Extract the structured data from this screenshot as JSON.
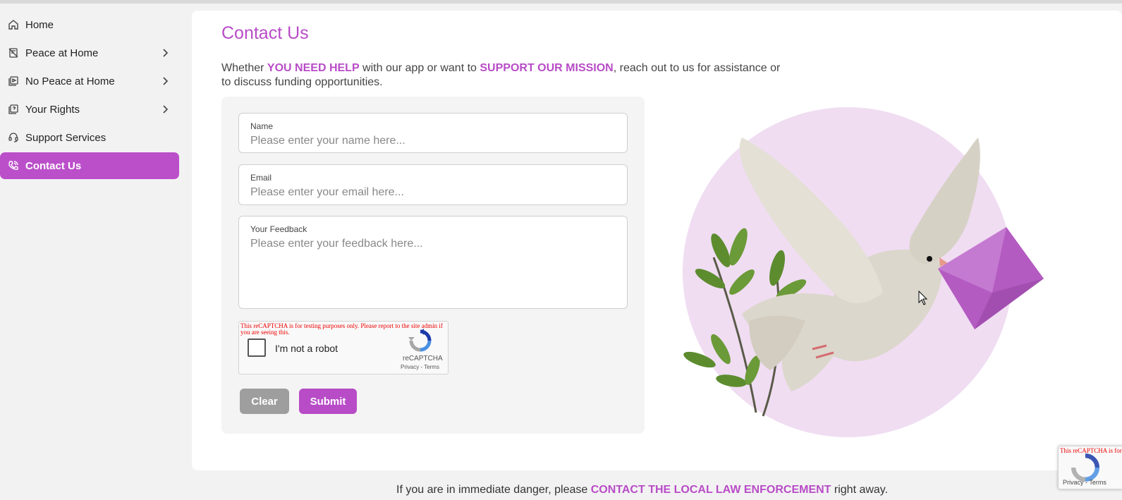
{
  "sidebar": {
    "items": [
      {
        "label": "Home",
        "icon": "home-icon",
        "has_submenu": false,
        "active": false
      },
      {
        "label": "Peace at Home",
        "icon": "no-fighting-icon",
        "has_submenu": true,
        "active": false
      },
      {
        "label": "No Peace at Home",
        "icon": "media-icon",
        "has_submenu": true,
        "active": false
      },
      {
        "label": "Your Rights",
        "icon": "help-book-icon",
        "has_submenu": true,
        "active": false
      },
      {
        "label": "Support Services",
        "icon": "headset-icon",
        "has_submenu": false,
        "active": false
      },
      {
        "label": "Contact Us",
        "icon": "phone-icon",
        "has_submenu": false,
        "active": true
      }
    ]
  },
  "main": {
    "title": "Contact Us",
    "intro": {
      "part1": "Whether ",
      "highlight1": "YOU NEED HELP",
      "part2": " with our app or want to ",
      "highlight2": "SUPPORT OUR MISSION",
      "part3": ", reach out to us for assistance or to discuss funding opportunities."
    }
  },
  "form": {
    "name": {
      "label": "Name",
      "placeholder": "Please enter your name here..."
    },
    "email": {
      "label": "Email",
      "placeholder": "Please enter your email here..."
    },
    "feedback": {
      "label": "Your Feedback",
      "placeholder": "Please enter your feedback here..."
    },
    "recaptcha": {
      "warning": "This reCAPTCHA is for testing purposes only. Please report to the site admin if you are seeing this.",
      "checkbox_label": "I'm not a robot",
      "brand": "reCAPTCHA",
      "terms": "Privacy - Terms"
    },
    "clear_label": "Clear",
    "submit_label": "Submit"
  },
  "footer": {
    "text_before": "If you are in immediate danger, please ",
    "highlight": "CONTACT THE LOCAL LAW ENFORCEMENT",
    "text_after": " right away."
  },
  "recaptcha_badge": {
    "warning": "This reCAPTCHA is for testing purposes only. Please report to the site admin if you are seeing this.",
    "terms": "Privacy - Terms"
  },
  "colors": {
    "accent": "#b84cc7",
    "sidebar_active": "#bb4fca",
    "clear_button": "#9e9e9e",
    "illustration_circle": "#f0ddf2",
    "envelope": "#b45bc2"
  }
}
